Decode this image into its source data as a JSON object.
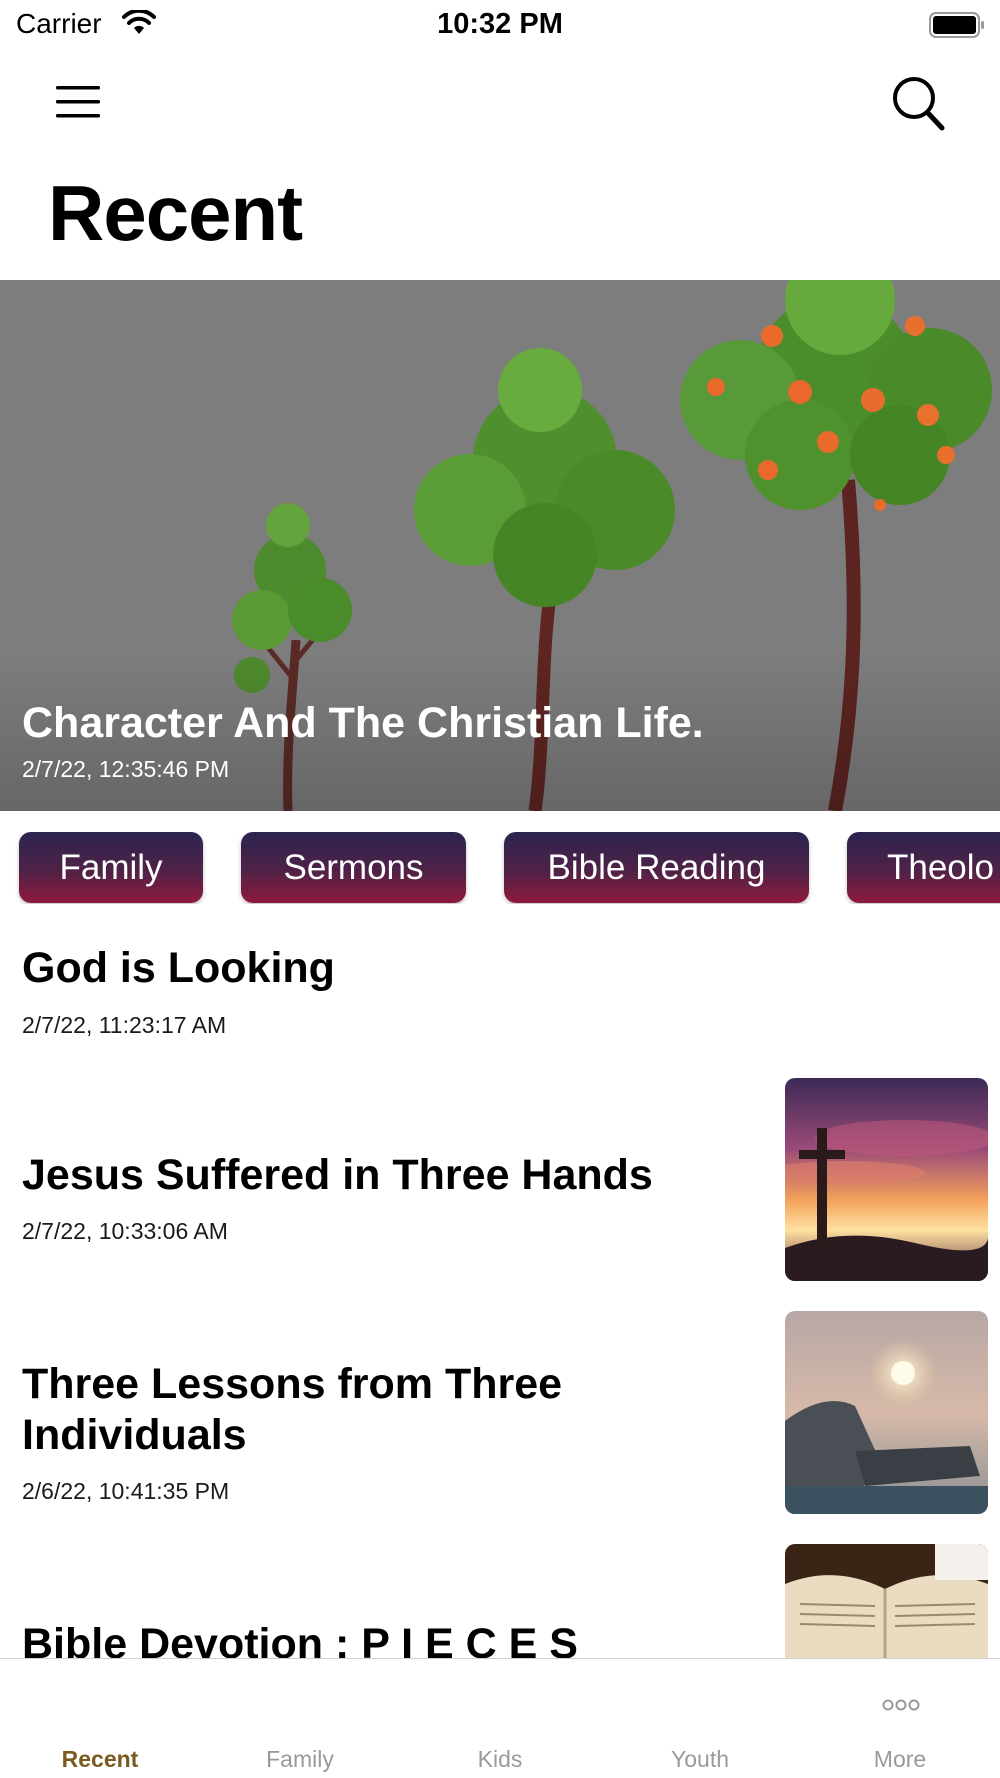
{
  "status_bar": {
    "carrier": "Carrier",
    "time": "10:32 PM"
  },
  "header": {
    "title": "Recent",
    "menu_icon": "hamburger-menu-icon",
    "search_icon": "search-icon"
  },
  "hero": {
    "title": "Character And The Christian Life.",
    "date": "2/7/22, 12:35:46 PM"
  },
  "categories": [
    "Family",
    "Sermons",
    "Bible Reading",
    "Theolo"
  ],
  "posts": [
    {
      "title": "God is Looking",
      "date": "2/7/22, 11:23:17 AM"
    },
    {
      "title": "Jesus Suffered in Three Hands",
      "date": "2/7/22, 10:33:06 AM"
    },
    {
      "title": "Three Lessons from Three Individuals",
      "date": "2/6/22, 10:41:35 PM"
    },
    {
      "title": "Bible Devotion : P I E C E S"
    }
  ],
  "tabs": [
    {
      "label": "Recent",
      "active": true
    },
    {
      "label": "Family"
    },
    {
      "label": "Kids"
    },
    {
      "label": "Youth"
    },
    {
      "label": "More",
      "icon": "more-icon"
    }
  ],
  "colors": {
    "accent": "#7a5a1f",
    "chip_top": "#2b2450",
    "chip_bottom": "#8e1a3c",
    "hero_bg": "#7b7b7b"
  }
}
